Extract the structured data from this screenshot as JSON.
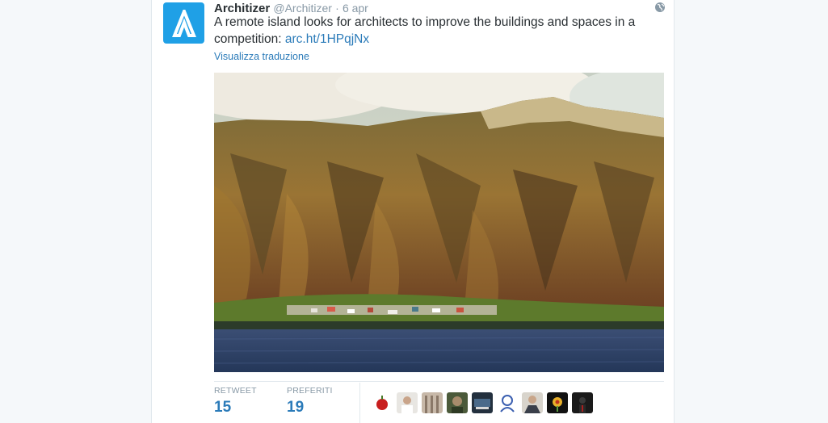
{
  "tweet": {
    "author_name": "Architizer",
    "author_handle": "@Architizer",
    "separator": "·",
    "date": "6 apr",
    "text": "A remote island looks for architects to improve the buildings and spaces in a competition: ",
    "link": "arc.ht/1HPqjNx",
    "translate_label": "Visualizza traduzione",
    "avatar_icon": "architizer-logo-icon",
    "globe_icon": "globe-icon",
    "photo_alt": "remote-island-photo"
  },
  "stats": {
    "retweet_label": "RETWEET",
    "retweet_count": "15",
    "favorites_label": "PREFERITI",
    "favorites_count": "19"
  },
  "colors": {
    "accent": "#2b7bb9",
    "avatar_bg": "#1fa0e6",
    "muted": "#8899a6"
  },
  "favoriters": [
    {
      "name": "apple-avatar"
    },
    {
      "name": "person-avatar"
    },
    {
      "name": "columns-avatar"
    },
    {
      "name": "portrait-avatar"
    },
    {
      "name": "desk-avatar"
    },
    {
      "name": "illustration-avatar"
    },
    {
      "name": "suit-avatar"
    },
    {
      "name": "flower-avatar"
    },
    {
      "name": "dark-avatar"
    }
  ]
}
